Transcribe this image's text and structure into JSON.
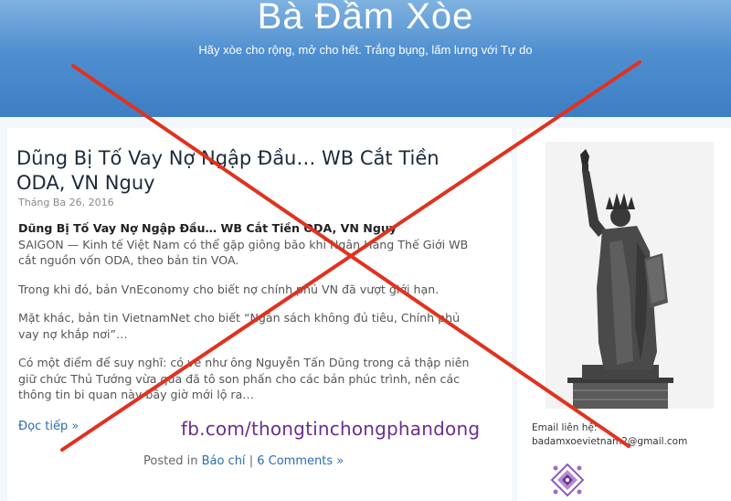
{
  "header": {
    "site_title": "Bà Đầm Xòe",
    "tagline": "Hãy xòe cho rộng, mở cho hết. Trắng bụng, lấm lưng với Tự do"
  },
  "post": {
    "title": "Dũng Bị Tố Vay Nợ Ngập Đầu… WB Cắt Tiền ODA, VN Nguy",
    "date": "Tháng Ba 26, 2016",
    "subheading": "Dũng Bị Tố Vay Nợ Ngập Đầu… WB Cắt Tiền ODA, VN Nguy",
    "paragraph_1": "SAIGON — Kinh tế Việt Nam có thể gặp giông bão khi Ngân Hàng Thế Giới WB cắt nguồn vốn ODA, theo bản tin VOA.",
    "paragraph_2": "Trong khi đó, bản VnEconomy cho biết nợ chính phủ VN đã vượt giới hạn.",
    "paragraph_3": "Mặt khác, bản tin VietnamNet cho biết “Ngân sách không đủ tiêu, Chính phủ vay nợ khắp nơi”…",
    "paragraph_4": "Có một điểm để suy nghĩ: có vẻ như ông Nguyễn Tấn Dũng trong cả thập niên giữ chức Thủ Tướng vừa qua đã tô son phấn cho các bản phúc trình, nên các thông tin bi quan này bây giờ mới lộ ra…",
    "read_more": "Đọc tiếp »",
    "posted_in_label": "Posted in",
    "category": "Báo chí",
    "separator": "|",
    "comments": "6 Comments »"
  },
  "sidebar": {
    "email_label": "Email liên hệ:",
    "email": "badamxoevietnam2@gmail.com"
  },
  "watermark": "fb.com/thongtinchongphandong",
  "colors": {
    "header_blue": "#4f8fd0",
    "link_blue": "#2a6db5",
    "cross_red": "#e0321f",
    "watermark_purple": "#6a2f8e"
  },
  "icons": {
    "statue": "statue-of-liberty-image",
    "ornament": "purple-ornament-icon"
  }
}
